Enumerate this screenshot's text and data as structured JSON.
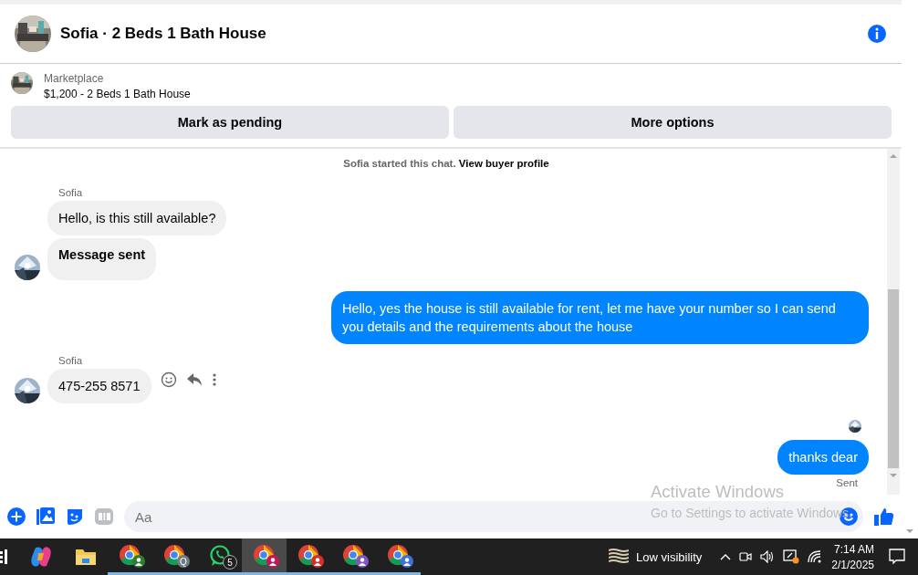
{
  "header": {
    "title": "Sofia · 2 Beds 1 Bath House"
  },
  "listing": {
    "source": "Marketplace",
    "title": "$1,200 - 2 Beds 1 Bath House"
  },
  "actions": [
    "Mark as pending",
    "More options"
  ],
  "messages": [
    {
      "kind": "system",
      "text": "Sofia started this chat.",
      "link": "View buyer profile"
    },
    {
      "kind": "incoming",
      "sender": "Sofia",
      "bubbles": [
        {
          "text": "Hello, is this still available?",
          "bold": false
        },
        {
          "text": "Message sent",
          "bold": true
        }
      ],
      "hover_actions": false
    },
    {
      "kind": "outgoing",
      "bubbles": [
        {
          "text": "Hello, yes the house is still available for rent, let me have your number so I can send you details and the requirements about the house",
          "bold": false
        }
      ]
    },
    {
      "kind": "incoming",
      "sender": "Sofia",
      "bubbles": [
        {
          "text": "475-255 8571",
          "bold": false
        }
      ],
      "hover_actions": true
    },
    {
      "kind": "receipt"
    },
    {
      "kind": "outgoing",
      "bubbles": [
        {
          "text": "thanks dear",
          "bold": false
        }
      ],
      "status": "Sent"
    }
  ],
  "composer": {
    "placeholder": "Aa"
  },
  "activation_notice": {
    "title": "Activate Windows",
    "text": "Go to Settings to activate Windows."
  },
  "taskbar": {
    "apps": [
      {
        "kind": "taskview",
        "selected": false,
        "running": false
      },
      {
        "kind": "copilot",
        "selected": false,
        "running": false
      },
      {
        "kind": "files",
        "selected": false,
        "running": false
      },
      {
        "kind": "chrome",
        "color": "#2e7d32",
        "selected": false,
        "running": true
      },
      {
        "kind": "chrome",
        "color": "#6e7a86",
        "badge": "Q",
        "selected": false,
        "running": true
      },
      {
        "kind": "whatsapp",
        "badge": "5",
        "selected": false,
        "running": true
      },
      {
        "kind": "chrome",
        "color": "#c2185b",
        "selected": true,
        "running": true
      },
      {
        "kind": "chrome",
        "color": "#d32f2f",
        "selected": false,
        "running": true
      },
      {
        "kind": "chrome",
        "color": "#7e57c2",
        "selected": false,
        "running": true
      },
      {
        "kind": "chrome",
        "color": "#3f6fd8",
        "selected": false,
        "running": true
      }
    ],
    "weather": "Low visibility",
    "time": "7:14 AM",
    "date": "2/1/2025"
  }
}
